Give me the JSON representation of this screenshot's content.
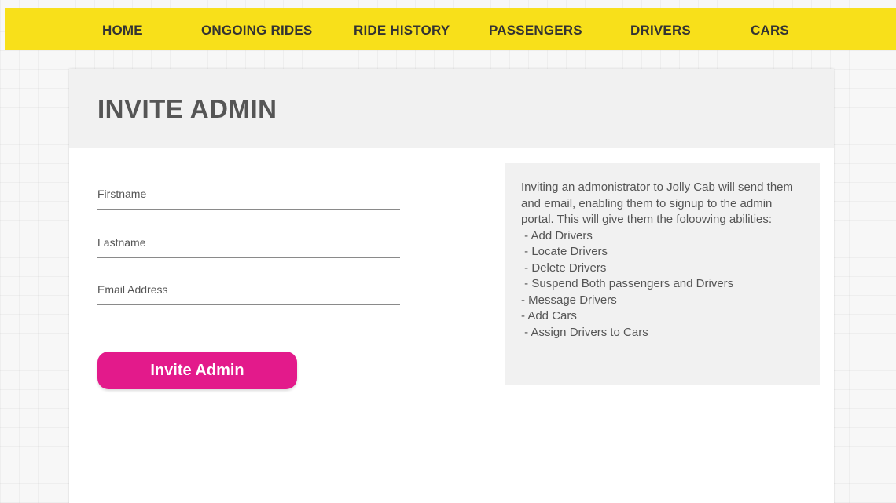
{
  "nav": {
    "items": [
      "HOME",
      "ONGOING RIDES",
      "RIDE HISTORY",
      "PASSENGERS",
      "DRIVERS",
      "CARS"
    ]
  },
  "page": {
    "title": "INVITE ADMIN"
  },
  "form": {
    "firstname_placeholder": "Firstname",
    "lastname_placeholder": "Lastname",
    "email_placeholder": "Email Address",
    "firstname_value": "",
    "lastname_value": "",
    "email_value": "",
    "submit_label": "Invite Admin"
  },
  "info": {
    "intro": "Inviting an admonistrator to Jolly Cab will send them and email, enabling them to signup to the admin portal. This will give them the foloowing abilities:",
    "abilities": [
      " - Add Drivers",
      " - Locate Drivers",
      " - Delete Drivers",
      " - Suspend Both passengers and Drivers",
      "- Message Drivers",
      "- Add Cars",
      " - Assign Drivers to Cars"
    ]
  },
  "colors": {
    "nav_background": "#f8e01a",
    "button_background": "#e31a8b",
    "header_background": "#f1f1f1",
    "text": "#555555"
  }
}
